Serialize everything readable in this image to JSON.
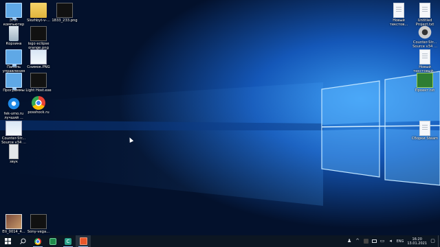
{
  "desktop": {
    "left_icons": [
      {
        "name": "this-pc-icon",
        "label": "Этот компьютер",
        "glyph": "g-monitor"
      },
      {
        "name": "slashbyt-icon",
        "label": "Slozhbyt-v-...",
        "glyph": "g-folder"
      },
      {
        "name": "png-file-icon",
        "label": "1833_233.png",
        "glyph": "g-dark"
      },
      {
        "name": "recycle-bin-icon",
        "label": "Корзина",
        "glyph": "g-recycle"
      },
      {
        "name": "logo-eclipse-icon",
        "label": "logo eclipse orange.png",
        "glyph": "g-dark"
      },
      {
        "name": "control-panel-icon",
        "label": "Панель управления",
        "glyph": "g-monitor"
      },
      {
        "name": "snimok-icon",
        "label": "Снимок.PNG",
        "glyph": "g-screen"
      },
      {
        "name": "programs-icon",
        "label": "Программы",
        "glyph": "g-monitor"
      },
      {
        "name": "lighthost-icon",
        "label": "Light Host.exe",
        "glyph": "g-dark"
      },
      {
        "name": "fix-settings-icon",
        "label": "fek-umo.ru лучший ...",
        "glyph": "g-gear"
      },
      {
        "name": "chrome-shortcut-icon",
        "label": "posshock.ru",
        "glyph": "g-chrome"
      },
      {
        "name": "counter-strike-left-icon",
        "label": "Counter-Str... Source v34 ...",
        "glyph": "g-screen"
      },
      {
        "name": "sound-file-icon",
        "label": "звук",
        "glyph": "g-speaker"
      },
      {
        "name": "photo-file-icon",
        "label": "Eti_0014_4...",
        "glyph": "g-photo"
      },
      {
        "name": "sony-vegas-icon",
        "label": "Sony-vega...",
        "glyph": "g-dark"
      }
    ],
    "right_icons": [
      {
        "name": "new-text-doc-1-icon",
        "label": "Новый текстов...",
        "glyph": "g-doc"
      },
      {
        "name": "untitled-project-icon",
        "label": "Untitled Project.txt",
        "glyph": "g-doc"
      },
      {
        "name": "counter-strike-right-icon",
        "label": "Counter-Str... Source v34 ...",
        "glyph": "g-steam"
      },
      {
        "name": "new-text-doc-2-icon",
        "label": "Новый текстовый...",
        "glyph": "g-doc"
      },
      {
        "name": "project-txt-icon",
        "label": "Проект.txt",
        "glyph": "g-green"
      },
      {
        "name": "steam-file-icon",
        "label": "Сборки Steam",
        "glyph": "g-doc"
      }
    ]
  },
  "taskbar": {
    "apps": [
      {
        "name": "start-button",
        "glyph": "⊞"
      },
      {
        "name": "search-button",
        "glyph": "⚲"
      },
      {
        "name": "chrome-taskbar-button",
        "glyph": "chrome"
      },
      {
        "name": "green-app-taskbar-button",
        "glyph": "green"
      },
      {
        "name": "camtasia-taskbar-button",
        "glyph": "C"
      },
      {
        "name": "orange-app-taskbar-button",
        "glyph": "orange"
      }
    ],
    "tray": {
      "language": "ENG",
      "time": "16:20",
      "date": "13.01.2021"
    }
  },
  "colors": {
    "taskbar_bg": "#0c1622",
    "wallpaper_dark": "#04122e",
    "wallpaper_light": "#2d86e0"
  }
}
